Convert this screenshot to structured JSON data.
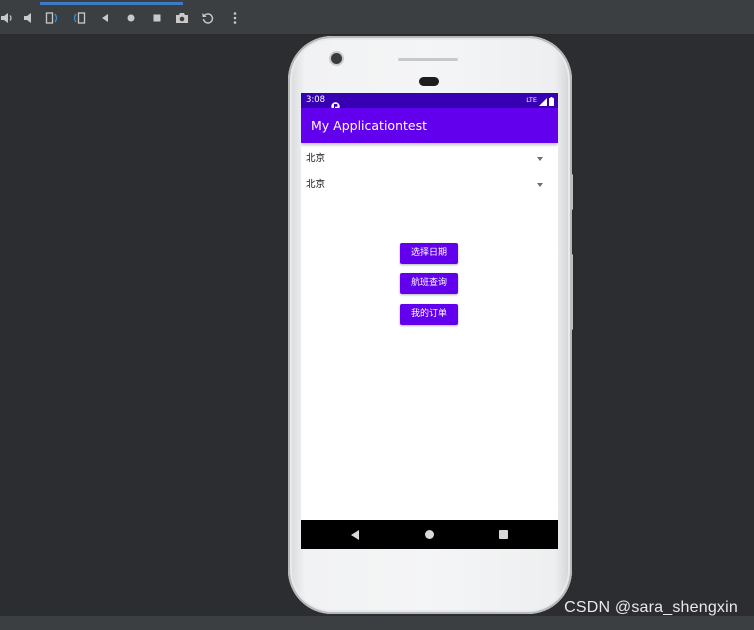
{
  "colors": {
    "ide_background": "#2b2d30",
    "toolbar": "#3c3f41",
    "status_bar": "#3700b3",
    "app_bar": "#6200ee",
    "button": "#6200ee",
    "nav_bar": "#000000"
  },
  "toolbar": {
    "icons": [
      "volume-up-icon",
      "volume-down-icon",
      "rotate-left-icon",
      "rotate-right-icon",
      "back-icon",
      "home-icon",
      "overview-icon",
      "screenshot-icon",
      "reset-icon",
      "more-icon"
    ]
  },
  "status_bar": {
    "time": "3:08",
    "network": "LTE",
    "icons": [
      "notification-icon",
      "signal-icon",
      "battery-icon"
    ]
  },
  "app_bar": {
    "title": "My Applicationtest"
  },
  "spinners": [
    {
      "value": "北京"
    },
    {
      "value": "北京"
    }
  ],
  "buttons": {
    "select_date": "选择日期",
    "flight_query": "航班查询",
    "my_orders": "我的订单"
  },
  "nav_bar": {
    "icons": [
      "nav-back-icon",
      "nav-home-icon",
      "nav-recents-icon"
    ]
  },
  "watermark": "CSDN @sara_shengxin"
}
